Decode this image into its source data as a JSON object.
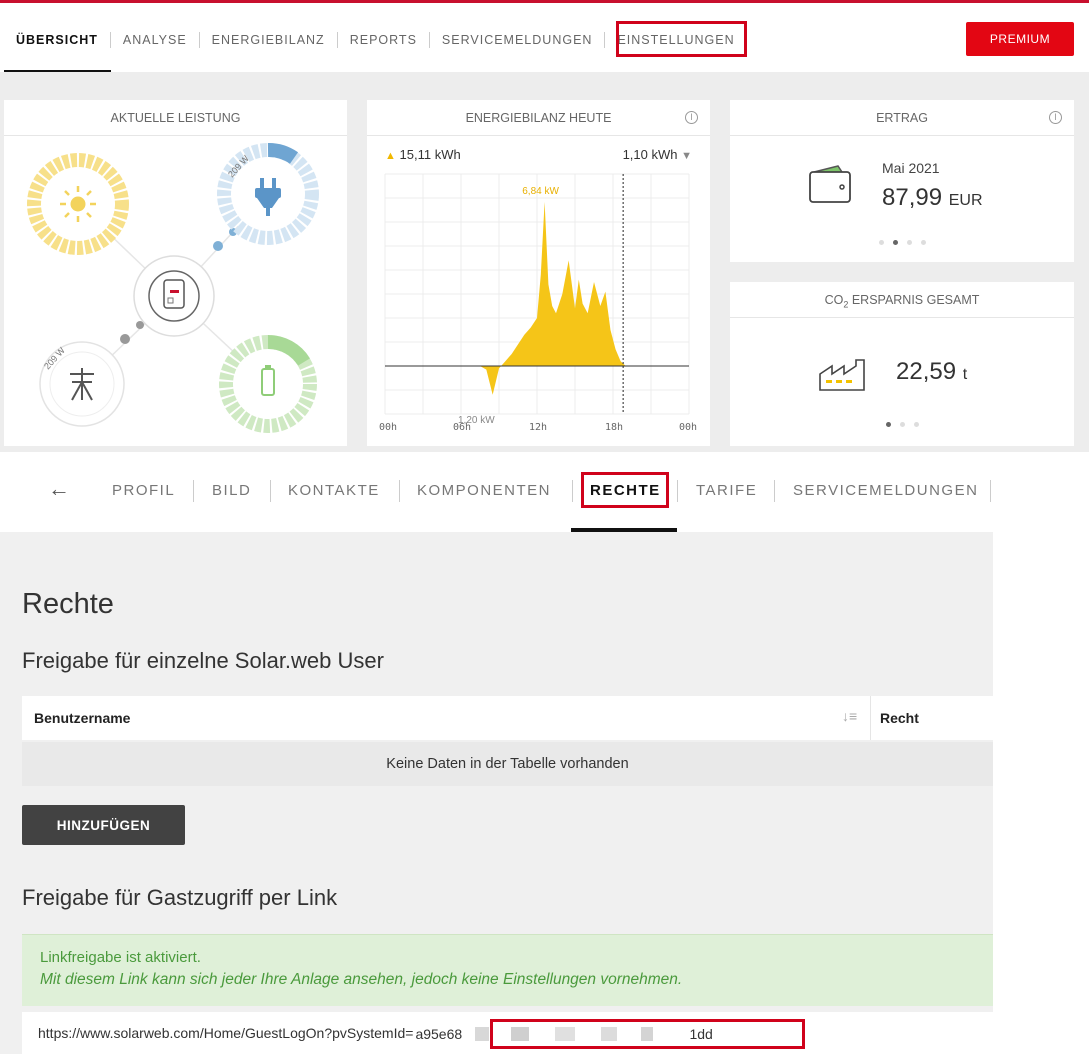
{
  "topnav": {
    "items": [
      "ÜBERSICHT",
      "ANALYSE",
      "ENERGIEBILANZ",
      "REPORTS",
      "SERVICEMELDUNGEN",
      "EINSTELLUNGEN"
    ],
    "premium_label": "PREMIUM"
  },
  "cards": {
    "leistung": {
      "title": "AKTUELLE LEISTUNG",
      "load_value": "209 W",
      "grid_value": "209 W"
    },
    "energiebilanz": {
      "title": "ENERGIEBILANZ HEUTE",
      "produced": "15,11 kWh",
      "consumed": "1,10 kWh",
      "peak_label": "6,84 kW",
      "min_label": "1,20 kW",
      "x_ticks": [
        "00h",
        "06h",
        "12h",
        "18h",
        "00h"
      ]
    },
    "ertrag": {
      "title": "ERTRAG",
      "period": "Mai 2021",
      "value": "87,99",
      "unit": "EUR"
    },
    "co2": {
      "title_prefix": "CO",
      "title_sub": "2",
      "title_suffix": " ERSPARNIS GESAMT",
      "value": "22,59",
      "unit": "t"
    }
  },
  "chart_data": {
    "type": "area",
    "title": "ENERGIEBILANZ HEUTE",
    "xlabel": "",
    "ylabel": "",
    "x_unit": "hour",
    "xlim": [
      0,
      24
    ],
    "ylim": [
      -2,
      8
    ],
    "x_ticks": [
      "00h",
      "06h",
      "12h",
      "18h",
      "00h"
    ],
    "annotations": [
      {
        "text": "6,84 kW",
        "x": 12.6,
        "y": 6.84
      },
      {
        "text": "1,20 kW",
        "x": 8.0,
        "y": -1.2
      }
    ],
    "series": [
      {
        "x": [
          0,
          4,
          6,
          7,
          7.5,
          8,
          8.5,
          9,
          9.5,
          10,
          10.5,
          11,
          11.5,
          12,
          12.3,
          12.6,
          12.9,
          13.2,
          13.5,
          14,
          14.5,
          15,
          15.3,
          15.6,
          16,
          16.5,
          17,
          17.4,
          17.8,
          18.2,
          18.6,
          19,
          24
        ],
        "values": [
          0,
          0,
          0,
          0,
          0,
          -0.15,
          -1.2,
          -0.1,
          0.2,
          0.5,
          0.9,
          1.3,
          1.6,
          2.0,
          3.8,
          6.84,
          3.4,
          2.5,
          2.2,
          3.0,
          4.4,
          2.4,
          3.6,
          2.6,
          2.2,
          3.5,
          2.5,
          3.1,
          1.5,
          0.7,
          0.2,
          0,
          0
        ]
      }
    ],
    "cursor_x": 18.8
  },
  "subnav": {
    "back_label": "←",
    "items": [
      "PROFIL",
      "BILD",
      "KONTAKTE",
      "KOMPONENTEN",
      "RECHTE",
      "TARIFE",
      "SERVICEMELDUNGEN"
    ]
  },
  "rechte": {
    "title": "Rechte",
    "users_heading": "Freigabe für einzelne Solar.web User",
    "col_username": "Benutzername",
    "col_recht": "Recht",
    "empty_text": "Keine Daten in der Tabelle vorhanden",
    "add_label": "HINZUFÜGEN",
    "guest_heading": "Freigabe für Gastzugriff per Link",
    "alert_line1": "Linkfreigabe ist aktiviert.",
    "alert_line2": "Mit diesem Link kann sich jeder Ihre Anlage ansehen, jedoch keine Einstellungen vornehmen.",
    "link_prefix": "https://www.solarweb.com/Home/GuestLogOn?pvSystemId=",
    "link_id_start": "a95e68",
    "link_id_end": "1dd"
  }
}
